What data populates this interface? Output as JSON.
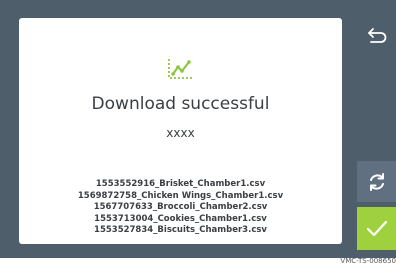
{
  "dialog": {
    "title": "Download successful",
    "subtitle": "xxxx",
    "files": [
      "1553552916_Brisket_Chamber1.csv",
      "1569872758_Chicken Wings_Chamber1.csv",
      "1567707633_Broccoli_Chamber2.csv",
      "1553713004_Cookies_Chamber1.csv",
      "1553527834_Biscuits_Chamber3.csv"
    ]
  },
  "icons": {
    "dialog_icon": "line-chart-icon",
    "back": "back-arrow-icon",
    "refresh": "refresh-icon",
    "confirm": "checkmark-icon"
  },
  "footer": {
    "figure_id": "VMC-TS-008650"
  },
  "colors": {
    "screen_bg": "#4f5e6b",
    "accent_green": "#9fd13e",
    "refresh_bg": "#617080"
  }
}
